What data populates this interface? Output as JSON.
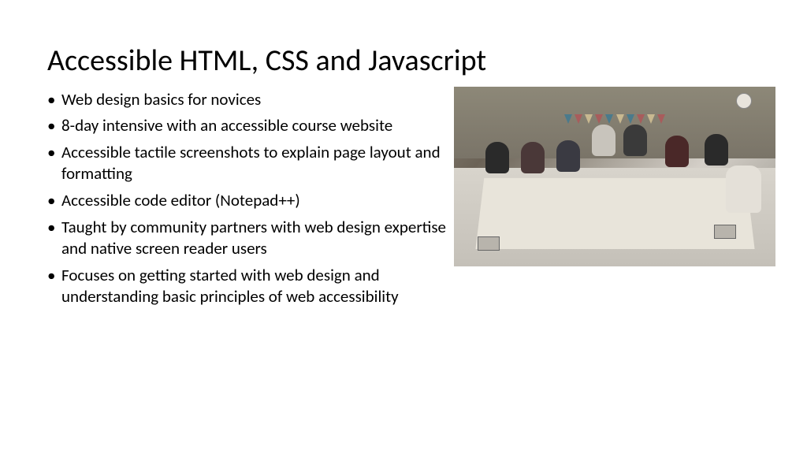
{
  "slide": {
    "title": "Accessible HTML, CSS and Javascript",
    "bullets": [
      "Web design basics for novices",
      "8-day intensive with an accessible course website",
      "Accessible tactile screenshots to explain page layout and formatting",
      "Accessible code editor (Notepad++)",
      "Taught by community partners with web design expertise and native screen reader users",
      "Focuses on getting started with web design and understanding basic principles of web accessibility"
    ],
    "image_alt": "Photo of people seated around a long table with laptops in a classroom with bunting flags on the wall"
  }
}
